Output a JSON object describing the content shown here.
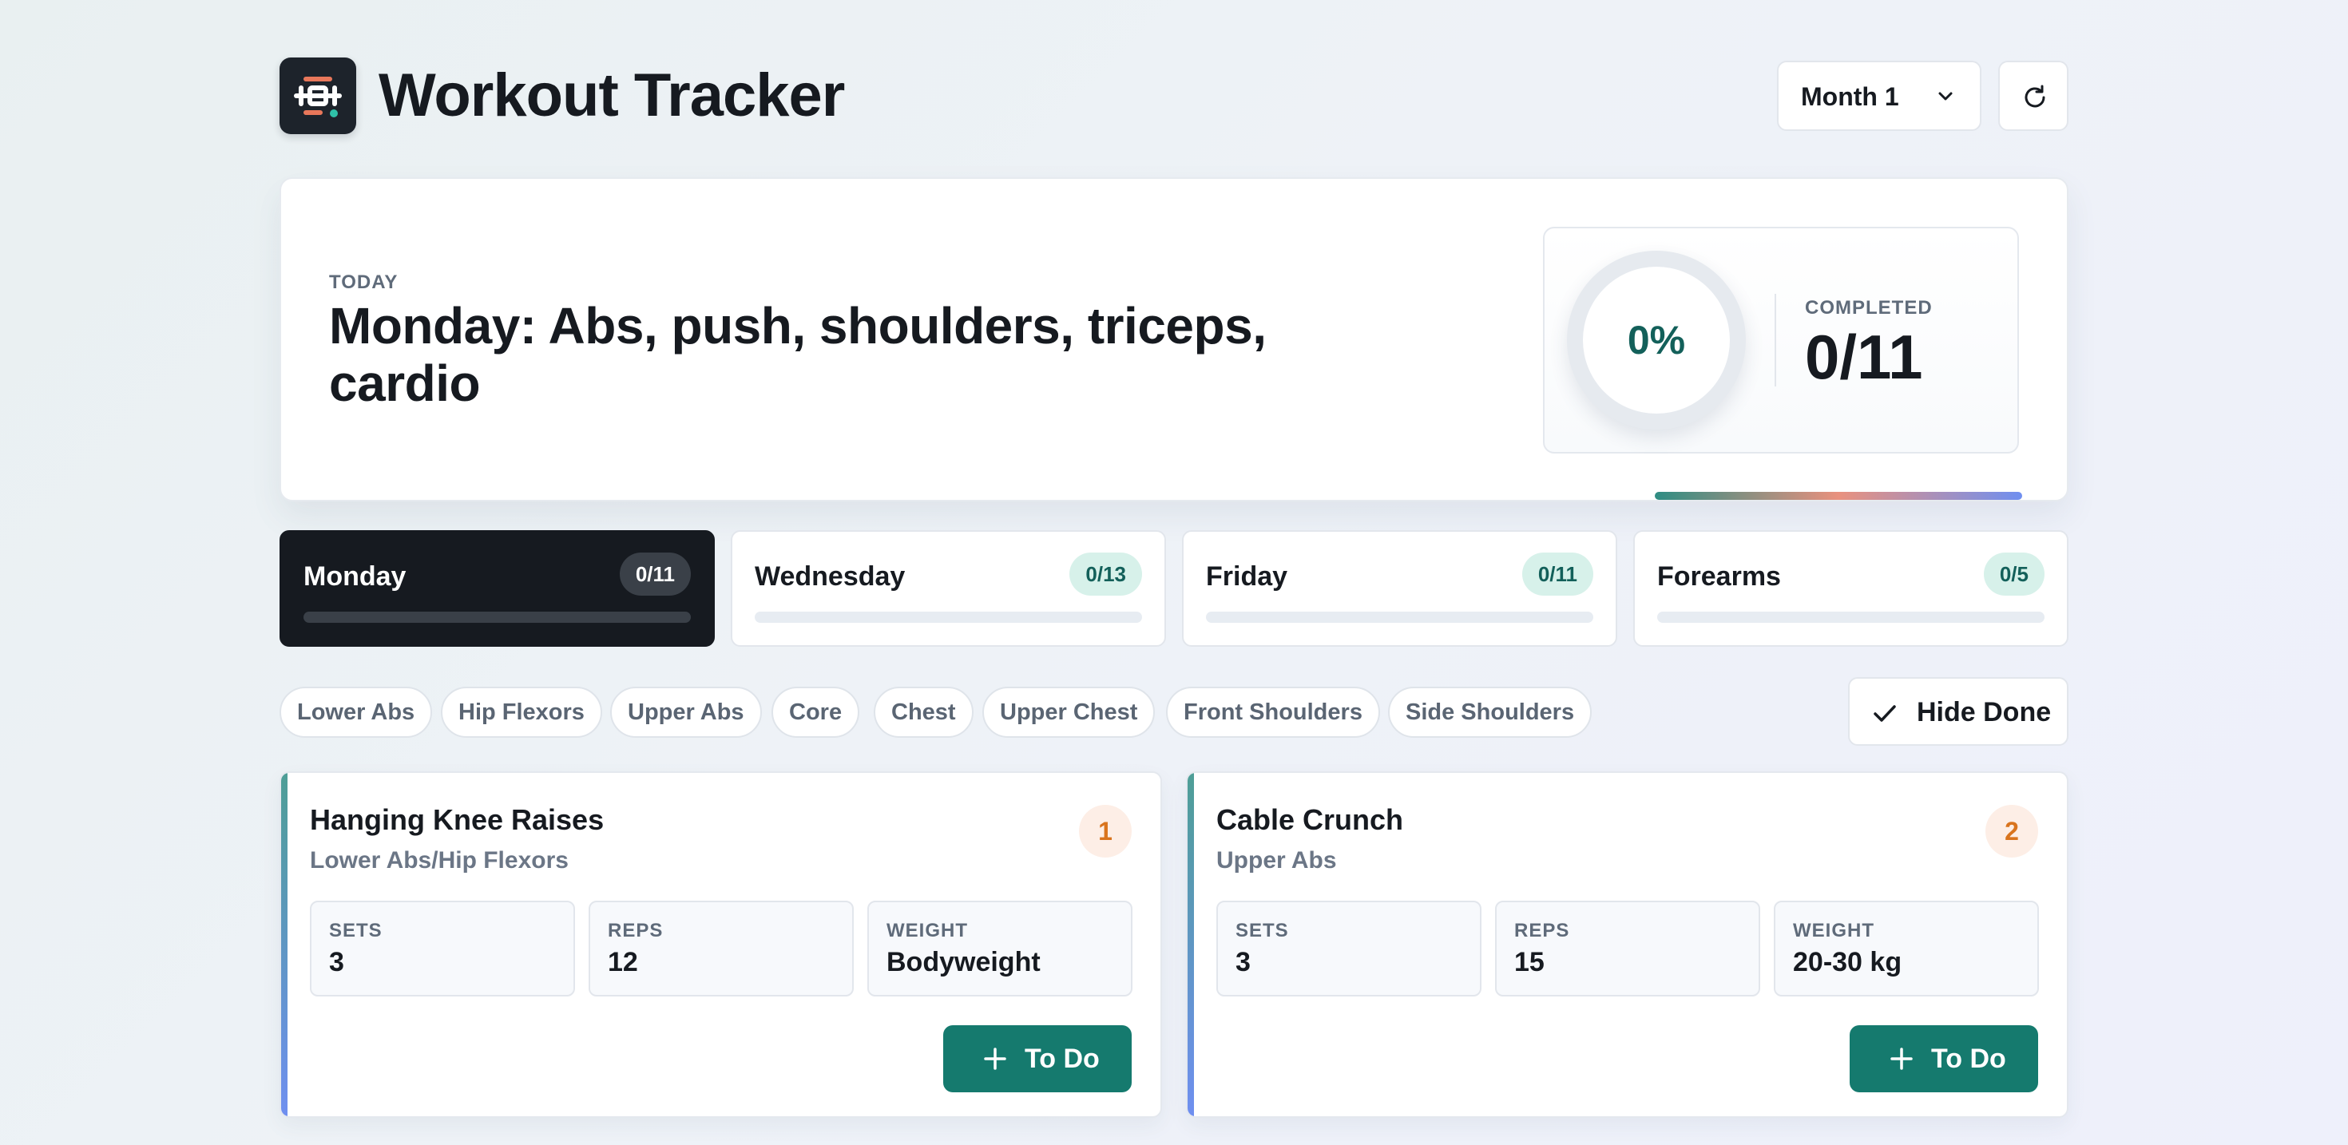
{
  "app": {
    "title": "Workout Tracker",
    "icon": "dumbbell-logo-icon"
  },
  "header": {
    "month_select": {
      "value": "Month 1",
      "icon": "chevron-down-icon"
    },
    "refresh_icon": "refresh-icon"
  },
  "today": {
    "label": "TODAY",
    "title": "Monday: Abs, push, shoulders, triceps, cardio",
    "progress_percent": "0%",
    "completed_label": "COMPLETED",
    "completed_value": "0/11",
    "completion_fraction": 0
  },
  "days": [
    {
      "label": "Monday",
      "count": "0/11",
      "active": true,
      "progress": 0
    },
    {
      "label": "Wednesday",
      "count": "0/13",
      "active": false,
      "progress": 0
    },
    {
      "label": "Friday",
      "count": "0/11",
      "active": false,
      "progress": 0
    },
    {
      "label": "Forearms",
      "count": "0/5",
      "active": false,
      "progress": 0
    }
  ],
  "filters": [
    "Lower Abs",
    "Hip Flexors",
    "Upper Abs",
    "Core",
    "Chest",
    "Upper Chest",
    "Front Shoulders",
    "Side Shoulders"
  ],
  "hide_done": {
    "label": "Hide Done",
    "icon": "check-icon",
    "checked": true
  },
  "exercises": [
    {
      "number": "1",
      "name": "Hanging Knee Raises",
      "group": "Lower Abs/Hip Flexors",
      "sets_label": "SETS",
      "sets": "3",
      "reps_label": "REPS",
      "reps": "12",
      "weight_label": "WEIGHT",
      "weight": "Bodyweight",
      "button_label": "To Do",
      "button_icon": "plus-icon"
    },
    {
      "number": "2",
      "name": "Cable Crunch",
      "group": "Upper Abs",
      "sets_label": "SETS",
      "sets": "3",
      "reps_label": "REPS",
      "reps": "15",
      "weight_label": "WEIGHT",
      "weight": "20-30 kg",
      "button_label": "To Do",
      "button_icon": "plus-icon"
    }
  ],
  "colors": {
    "accent_teal": "#157a6e",
    "dark": "#161a20",
    "badge_bg": "#d7f1ea",
    "number_orange": "#d9741e"
  }
}
